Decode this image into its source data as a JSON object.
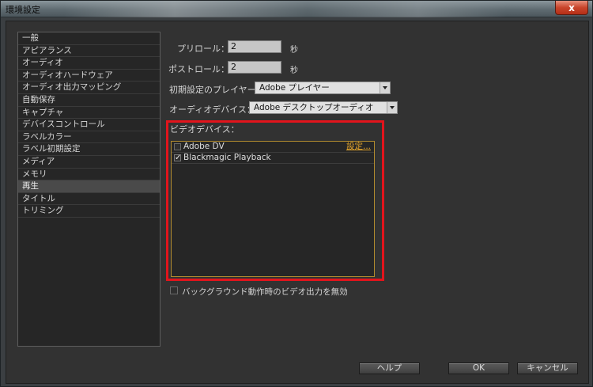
{
  "window": {
    "title": "環境設定",
    "close_label": "x"
  },
  "categories": [
    {
      "label": "一般"
    },
    {
      "label": "アピアランス"
    },
    {
      "label": "オーディオ"
    },
    {
      "label": "オーディオハードウェア"
    },
    {
      "label": "オーディオ出力マッピング"
    },
    {
      "label": "自動保存"
    },
    {
      "label": "キャプチャ"
    },
    {
      "label": "デバイスコントロール"
    },
    {
      "label": "ラベルカラー"
    },
    {
      "label": "ラベル初期設定"
    },
    {
      "label": "メディア"
    },
    {
      "label": "メモリ"
    },
    {
      "label": "再生",
      "selected": true
    },
    {
      "label": "タイトル"
    },
    {
      "label": "トリミング"
    }
  ],
  "playback": {
    "preroll_label": "プリロール：",
    "preroll_value": "2",
    "postroll_label": "ポストロール：",
    "postroll_value": "2",
    "seconds_unit": "秒",
    "player_label": "初期設定のプレイヤー：",
    "player_value": "Adobe プレイヤー",
    "audio_device_label": "オーディオデバイス：",
    "audio_device_value": "Adobe デスクトップオーディオ",
    "video_device_label": "ビデオデバイス：",
    "video_devices": [
      {
        "name": "Adobe DV",
        "checked": false,
        "settings_label": "設定..."
      },
      {
        "name": "Blackmagic Playback",
        "checked": true
      }
    ],
    "disable_bg_label": "バックグラウンド動作時のビデオ出力を無効",
    "disable_bg_checked": false
  },
  "buttons": {
    "help": "ヘルプ",
    "ok": "OK",
    "cancel": "キャンセル"
  },
  "colors": {
    "highlight": "#e2141c",
    "link": "#e0a22a",
    "close": "#c9452b"
  }
}
